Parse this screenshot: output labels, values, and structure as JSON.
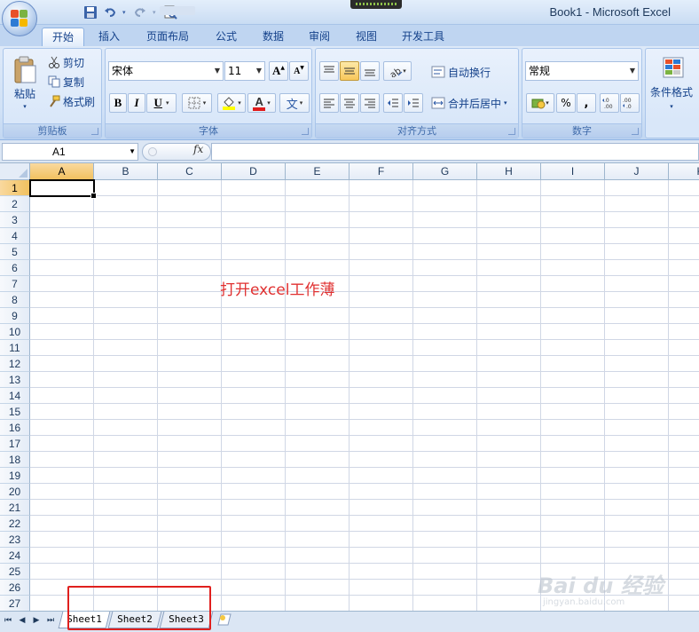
{
  "window": {
    "title": "Book1 - Microsoft Excel"
  },
  "quick_access": {
    "items": [
      "save-icon",
      "undo-icon",
      "redo-icon",
      "print-preview-icon",
      "customize-icon"
    ]
  },
  "tabs": [
    {
      "label": "开始",
      "active": true
    },
    {
      "label": "插入"
    },
    {
      "label": "页面布局"
    },
    {
      "label": "公式"
    },
    {
      "label": "数据"
    },
    {
      "label": "审阅"
    },
    {
      "label": "视图"
    },
    {
      "label": "开发工具"
    }
  ],
  "ribbon": {
    "clipboard": {
      "label": "剪贴板",
      "paste": "粘贴",
      "cut": "剪切",
      "copy": "复制",
      "format_painter": "格式刷"
    },
    "font": {
      "label": "字体",
      "font_name": "宋体",
      "font_size": "11",
      "bold": "B",
      "italic": "I",
      "underline": "U",
      "grow": "A",
      "shrink": "A",
      "font_color_glyph": "A",
      "phonetic": "文"
    },
    "alignment": {
      "label": "对齐方式",
      "wrap_text": "自动换行",
      "merge_center": "合并后居中"
    },
    "number": {
      "label": "数字",
      "format": "常规",
      "percent": "%",
      "comma": ","
    },
    "styles": {
      "conditional_format": "条件格式"
    }
  },
  "formula_bar": {
    "name_box": "A1",
    "fx": "fx",
    "value": ""
  },
  "grid": {
    "columns": [
      "A",
      "B",
      "C",
      "D",
      "E",
      "F",
      "G",
      "H",
      "I",
      "J",
      "K"
    ],
    "rows": [
      "1",
      "2",
      "3",
      "4",
      "5",
      "6",
      "7",
      "8",
      "9",
      "10",
      "11",
      "12",
      "13",
      "14",
      "15",
      "16",
      "17",
      "18",
      "19",
      "20",
      "21",
      "22",
      "23",
      "24",
      "25",
      "26",
      "27"
    ],
    "selected_column": "A",
    "selected_row": "1",
    "annotation": "打开excel工作薄"
  },
  "sheets": [
    {
      "label": "Sheet1",
      "active": true
    },
    {
      "label": "Sheet2"
    },
    {
      "label": "Sheet3"
    }
  ],
  "highlight_color": "#e0201e",
  "watermark": {
    "brand": "Bai du 经验",
    "url": "jingyan.baidu.com"
  }
}
